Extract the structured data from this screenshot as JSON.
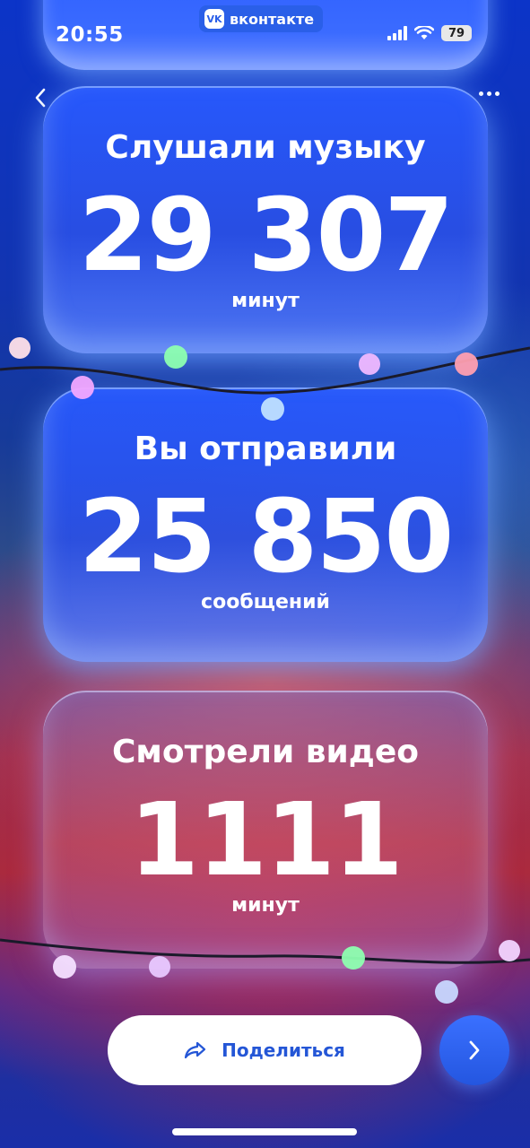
{
  "status": {
    "time": "20:55",
    "battery": "79"
  },
  "app_badge": {
    "label": "вконтакте",
    "logo": "VK"
  },
  "nav": {
    "back_icon": "chevron-left-icon",
    "more_icon": "more-dots-icon"
  },
  "cards": [
    {
      "label": "Слушали музыку",
      "value": "29 307",
      "unit": "минут"
    },
    {
      "label": "Вы отправили",
      "value": "25 850",
      "unit": "сообщений"
    },
    {
      "label": "Смотрели видео",
      "value": "1111",
      "unit": "минут"
    }
  ],
  "actions": {
    "share_label": "Поделиться",
    "share_icon": "share-arrow-icon",
    "next_icon": "chevron-right-icon"
  },
  "colors": {
    "accent": "#2456d6",
    "card_blue": "#2a5cff"
  }
}
